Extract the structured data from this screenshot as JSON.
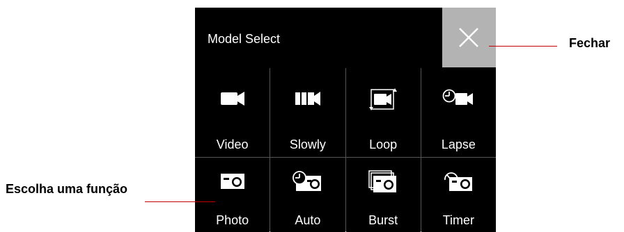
{
  "header": {
    "title": "Model Select",
    "close_icon": "close-icon"
  },
  "modes": [
    {
      "label": "Video",
      "icon": "video-camera-icon"
    },
    {
      "label": "Slowly",
      "icon": "slow-motion-icon"
    },
    {
      "label": "Loop",
      "icon": "loop-recording-icon"
    },
    {
      "label": "Lapse",
      "icon": "time-lapse-icon"
    },
    {
      "label": "Photo",
      "icon": "photo-camera-icon"
    },
    {
      "label": "Auto",
      "icon": "auto-photo-icon"
    },
    {
      "label": "Burst",
      "icon": "burst-photo-icon"
    },
    {
      "label": "Timer",
      "icon": "self-timer-icon"
    }
  ],
  "annotations": {
    "close": "Fechar",
    "choose": "Escolha uma função"
  },
  "colors": {
    "panel": "#000000",
    "close_button": "#b3b3b3",
    "grid_lines": "#555555",
    "annotation_line": "#c00000"
  }
}
